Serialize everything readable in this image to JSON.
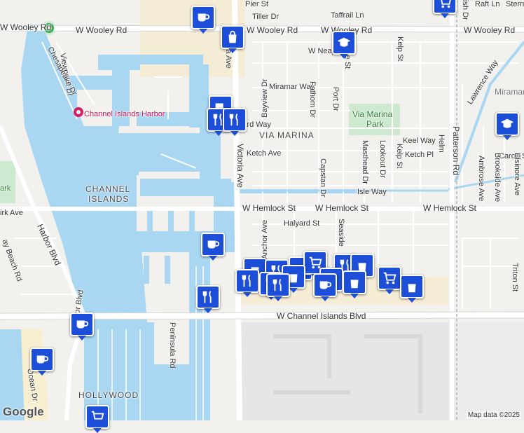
{
  "map": {
    "streets": {
      "w_wooley_rd_left": "W Wooley Rd",
      "w_wooley_rd_mid": "W Wooley Rd",
      "w_wooley_rd_right": "W Wooley Rd",
      "w_wooley_rd_far": "W Wooley Rd",
      "w_wooley_rd_edge": "W Wooley Rd",
      "pier_st": "Pier St",
      "tiller_dr": "Tiller Dr",
      "taffrail_ln": "Taffrail Ln",
      "raft_ln": "Raft Ln",
      "stern": "Stern",
      "w_neap": "W Neap",
      "miramar_way": "Miramar Way",
      "leeward_way": "Leeward Way",
      "ketch_ave": "Ketch Ave",
      "keel_way": "Keel Way",
      "ketch_pl": "Ketch Pl",
      "carob_st": "Carob St",
      "isle_way": "Isle Way",
      "w_hemlock_st_1": "W Hemlock St",
      "w_hemlock_st_2": "W Hemlock St",
      "w_hemlock_st_3": "W Hemlock St",
      "halyard_st": "Halyard St",
      "w_channel_islands_blvd": "W Channel Islands Blvd",
      "victoria_ave_1": "ia Ave",
      "victoria_ave_2": "Victoria Ave",
      "harbor_blvd_1": "Harbor Blvd",
      "harbor_blvd_2": "Harbor Blvd",
      "peninsula_rd": "Peninsula Rd",
      "ocean_dr": "Ocean Dr",
      "viewpoint_dr": "Viewpoint Dr",
      "chesapeake_dr": "Chesapeake Dr",
      "bayview_dr": "Bayview Dr",
      "fathom_dr": "Fathom Dr",
      "port_dr": "Port Dr",
      "capstan_dr": "Capstan Dr",
      "anchor_ave": "Anchor Ave",
      "seaside": "Seaside",
      "masthead_dr": "Masthead Dr",
      "lookout_dr": "Lookout Dr",
      "kelp_st_1": "Kelp St",
      "kelp_st_2": "Kelp St",
      "helm": "Helm",
      "patterson_rd": "Patterson Rd",
      "ambrose_ave": "Ambrose Ave",
      "brookside_ave": "Brookside Ave",
      "elsinore_ave": "Elsinore Ave",
      "lawrence_way": "Lawrence Way",
      "triton_st": "Triton St",
      "kirk_ave": "irk Ave",
      "bay_beach_rd": "ay Beach Rd",
      "ish_dr": "ish Dr",
      "re_st": "re St"
    },
    "areas": {
      "channel_islands_1": "CHANNEL",
      "channel_islands_2": "ISLANDS",
      "via_marina": "VIA MARINA",
      "hollywood": "HOLLYWOOD",
      "miramar": "Miramar",
      "park_edge": "ark"
    },
    "places": {
      "channel_islands_harbor": "Channel Islands Harbor",
      "via_marina_park_1": "Via Marina",
      "via_marina_park_2": "Park"
    },
    "attribution": "Map data ©2025",
    "logo": "Google"
  },
  "markers": [
    {
      "type": "cafe",
      "icon": "cafe-icon"
    },
    {
      "type": "shopping",
      "icon": "shopping-bag-icon"
    },
    {
      "type": "school",
      "icon": "school-icon"
    },
    {
      "type": "shopping-cart",
      "icon": "cart-icon"
    },
    {
      "type": "restaurant",
      "icon": "restaurant-icon"
    },
    {
      "type": "cafe",
      "icon": "cafe-icon"
    },
    {
      "type": "school",
      "icon": "school-icon"
    }
  ],
  "colors": {
    "water": "#a9d7f2",
    "land": "#f2f1ee",
    "road_major": "#ffffff",
    "road_minor": "#ffffff",
    "park": "#cde9cf",
    "commercial": "#f5ecd6",
    "marker": "#1d4ed8"
  }
}
